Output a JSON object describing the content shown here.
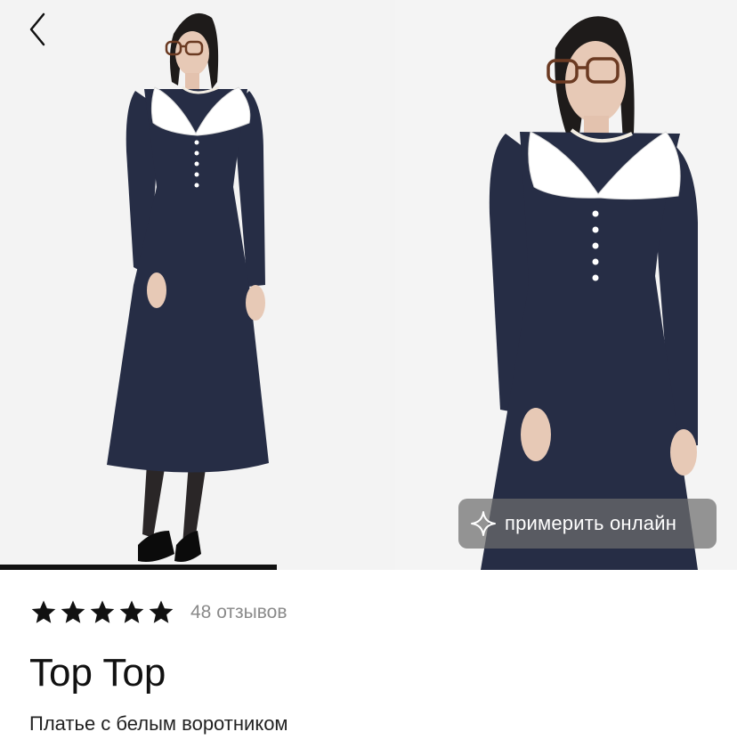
{
  "gallery": {
    "try_on_label": "примерить онлайн",
    "progress_fraction": 0.375,
    "photos": [
      {
        "icon": "product-photo-full-length"
      },
      {
        "icon": "product-photo-closeup"
      }
    ]
  },
  "header": {
    "back_icon": "chevron-left-icon"
  },
  "product": {
    "rating": 5,
    "max_rating": 5,
    "reviews_label": "48 отзывов",
    "brand": "Top Top",
    "name": "Платье с белым воротником"
  },
  "colors": {
    "accent": "#111111",
    "star": "#111111",
    "secondary_text": "#8a8a8a",
    "dress": "#262d45",
    "collar": "#ffffff",
    "try_on_bg": "#6e6e6e"
  }
}
